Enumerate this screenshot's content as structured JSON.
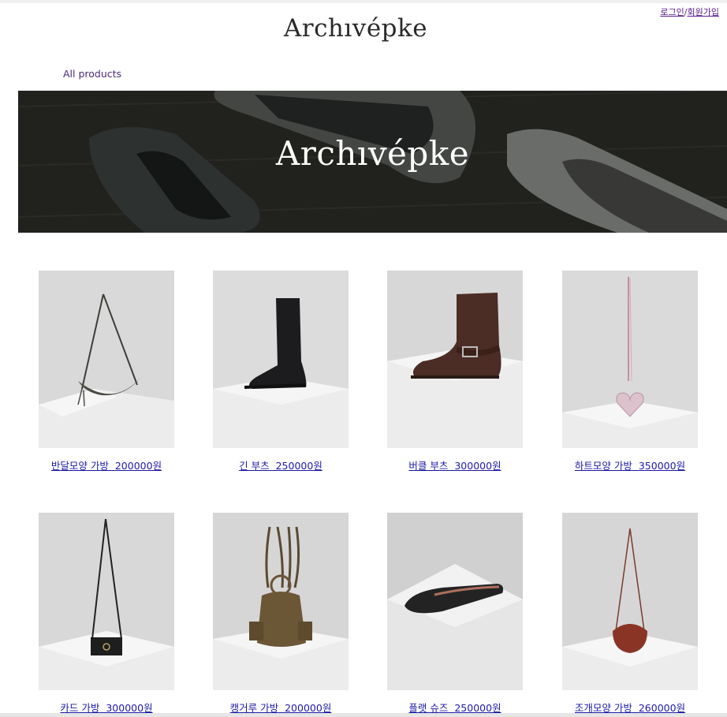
{
  "header": {
    "login_label": "로그인",
    "separator": "/",
    "signup_label": "회원가입",
    "logo_text": "Archıvépke",
    "nav_all_products": "All products"
  },
  "banner": {
    "title": "Archıvépke"
  },
  "products": [
    {
      "name": "반달모양 가방",
      "price": "200000원",
      "image": "half-moon-bag-image"
    },
    {
      "name": "긴 부츠",
      "price": "250000원",
      "image": "long-boots-image"
    },
    {
      "name": "버클 부츠",
      "price": "300000원",
      "image": "buckle-boots-image"
    },
    {
      "name": "하트모양 가방",
      "price": "350000원",
      "image": "heart-bag-image"
    },
    {
      "name": "카드 가방",
      "price": "300000원",
      "image": "card-bag-image"
    },
    {
      "name": "캥거루 가방",
      "price": "200000원",
      "image": "kangaroo-bag-image"
    },
    {
      "name": "플랫 슈즈",
      "price": "250000원",
      "image": "flat-shoes-image"
    },
    {
      "name": "조개모양 가방",
      "price": "260000원",
      "image": "shell-bag-image"
    }
  ],
  "colors": {
    "link": "#1a1aa6",
    "visited": "#551a8b",
    "banner_bg": "#2a2a28"
  }
}
